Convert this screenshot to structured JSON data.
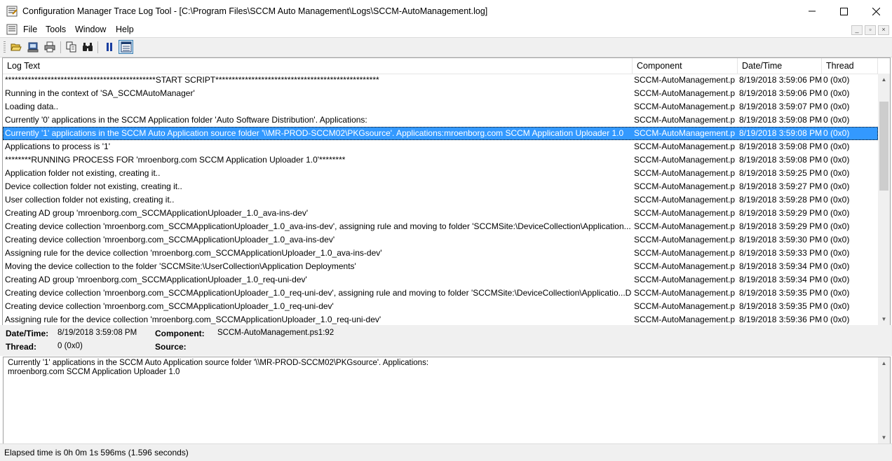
{
  "window": {
    "title": "Configuration Manager Trace Log Tool - [C:\\Program Files\\SCCM Auto Management\\Logs\\SCCM-AutoManagement.log]",
    "minimize_icon": "minimize-icon",
    "maximize_icon": "maximize-icon",
    "close_icon": "close-icon"
  },
  "menu": {
    "items": [
      "File",
      "Tools",
      "Window",
      "Help"
    ]
  },
  "toolbar": {
    "buttons": [
      "open-icon",
      "open-server-icon",
      "print-icon",
      "copy-icon",
      "find-icon",
      "pause-icon",
      "details-icon"
    ]
  },
  "columns": {
    "log_text": "Log Text",
    "component": "Component",
    "datetime": "Date/Time",
    "thread": "Thread"
  },
  "rows": [
    {
      "text": "**********************************************START SCRIPT**************************************************",
      "component": "SCCM-AutoManagement.p",
      "datetime": "8/19/2018 3:59:06 PM",
      "thread": "0 (0x0)"
    },
    {
      "text": "Running in the context of 'SA_SCCMAutoManager'",
      "component": "SCCM-AutoManagement.p",
      "datetime": "8/19/2018 3:59:06 PM",
      "thread": "0 (0x0)"
    },
    {
      "text": "Loading data..",
      "component": "SCCM-AutoManagement.p",
      "datetime": "8/19/2018 3:59:07 PM",
      "thread": "0 (0x0)"
    },
    {
      "text": "Currently '0' applications in the SCCM Application folder 'Auto Software Distribution'. Applications:",
      "component": "SCCM-AutoManagement.p",
      "datetime": "8/19/2018 3:59:08 PM",
      "thread": "0 (0x0)"
    },
    {
      "text": "Currently '1' applications in the SCCM Auto Application source folder '\\\\MR-PROD-SCCM02\\PKGsource'. Applications:mroenborg.com SCCM Application Uploader 1.0",
      "component": "SCCM-AutoManagement.p",
      "datetime": "8/19/2018 3:59:08 PM",
      "thread": "0 (0x0)",
      "selected": true
    },
    {
      "text": "Applications to process is '1'",
      "component": "SCCM-AutoManagement.p",
      "datetime": "8/19/2018 3:59:08 PM",
      "thread": "0 (0x0)"
    },
    {
      "text": "********RUNNING PROCESS FOR 'mroenborg.com SCCM Application Uploader 1.0'********",
      "component": "SCCM-AutoManagement.p",
      "datetime": "8/19/2018 3:59:08 PM",
      "thread": "0 (0x0)"
    },
    {
      "text": "Application folder not existing, creating it..",
      "component": "SCCM-AutoManagement.p",
      "datetime": "8/19/2018 3:59:25 PM",
      "thread": "0 (0x0)"
    },
    {
      "text": "Device collection folder not existing, creating it..",
      "component": "SCCM-AutoManagement.p",
      "datetime": "8/19/2018 3:59:27 PM",
      "thread": "0 (0x0)"
    },
    {
      "text": "User collection folder not existing, creating it..",
      "component": "SCCM-AutoManagement.p",
      "datetime": "8/19/2018 3:59:28 PM",
      "thread": "0 (0x0)"
    },
    {
      "text": "Creating AD group 'mroenborg.com_SCCMApplicationUploader_1.0_ava-ins-dev'",
      "component": "SCCM-AutoManagement.p",
      "datetime": "8/19/2018 3:59:29 PM",
      "thread": "0 (0x0)"
    },
    {
      "text": "Creating device collection 'mroenborg.com_SCCMApplicationUploader_1.0_ava-ins-dev', assigning rule and moving to folder 'SCCMSite:\\DeviceCollection\\Application...",
      "component": "SCCM-AutoManagement.p",
      "datetime": "8/19/2018 3:59:29 PM",
      "thread": "0 (0x0)"
    },
    {
      "text": "Creating device collection 'mroenborg.com_SCCMApplicationUploader_1.0_ava-ins-dev'",
      "component": "SCCM-AutoManagement.p",
      "datetime": "8/19/2018 3:59:30 PM",
      "thread": "0 (0x0)"
    },
    {
      "text": "Assigning rule for the device collection 'mroenborg.com_SCCMApplicationUploader_1.0_ava-ins-dev'",
      "component": "SCCM-AutoManagement.p",
      "datetime": "8/19/2018 3:59:33 PM",
      "thread": "0 (0x0)"
    },
    {
      "text": "Moving the device collection to the folder 'SCCMSite:\\UserCollection\\Application Deployments'",
      "component": "SCCM-AutoManagement.p",
      "datetime": "8/19/2018 3:59:34 PM",
      "thread": "0 (0x0)"
    },
    {
      "text": "Creating AD group 'mroenborg.com_SCCMApplicationUploader_1.0_req-uni-dev'",
      "component": "SCCM-AutoManagement.p",
      "datetime": "8/19/2018 3:59:34 PM",
      "thread": "0 (0x0)"
    },
    {
      "text": "Creating device collection 'mroenborg.com_SCCMApplicationUploader_1.0_req-uni-dev', assigning rule and moving to folder 'SCCMSite:\\DeviceCollection\\Applicatio...D",
      "component": "SCCM-AutoManagement.p",
      "datetime": "8/19/2018 3:59:35 PM",
      "thread": "0 (0x0)"
    },
    {
      "text": "Creating device collection 'mroenborg.com_SCCMApplicationUploader_1.0_req-uni-dev'",
      "component": "SCCM-AutoManagement.p",
      "datetime": "8/19/2018 3:59:35 PM",
      "thread": "0 (0x0)"
    },
    {
      "text": "Assigning rule for the device collection 'mroenborg.com_SCCMApplicationUploader_1.0_req-uni-dev'",
      "component": "SCCM-AutoManagement.p",
      "datetime": "8/19/2018 3:59:36 PM",
      "thread": "0 (0x0)"
    }
  ],
  "details": {
    "datetime_label": "Date/Time:",
    "datetime_value": "8/19/2018 3:59:08 PM",
    "component_label": "Component:",
    "component_value": "SCCM-AutoManagement.ps1:92",
    "thread_label": "Thread:",
    "thread_value": "0 (0x0)",
    "source_label": "Source:",
    "source_value": ""
  },
  "message": "Currently '1' applications in the SCCM Auto Application source folder '\\\\MR-PROD-SCCM02\\PKGsource'. Applications:\nmroenborg.com SCCM Application Uploader 1.0",
  "status": {
    "text": "Elapsed time is 0h 0m 1s 596ms (1.596 seconds)"
  },
  "colors": {
    "selection": "#3399ff",
    "chrome": "#f0f0f0"
  }
}
